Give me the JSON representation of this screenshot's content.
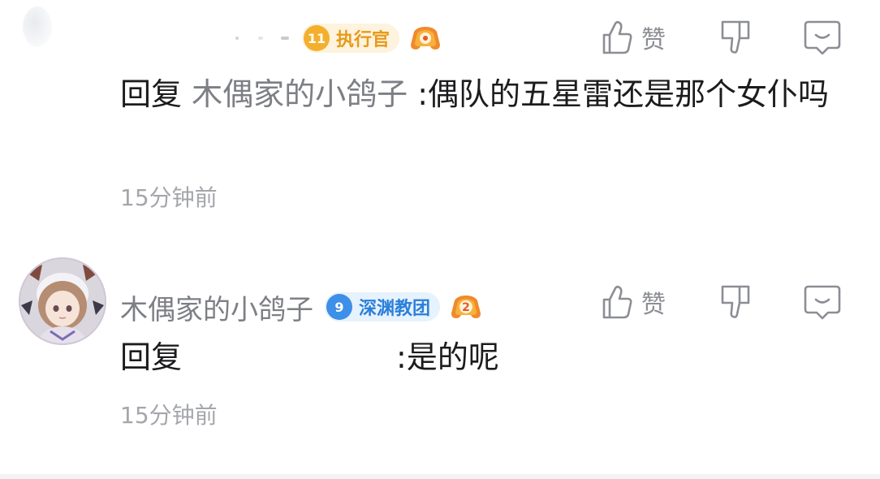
{
  "comments": [
    {
      "username": "",
      "level": "11",
      "level_title": "执行官",
      "level_color": "#f4b02d",
      "medal_icon": "game-controller-medal-icon",
      "reply_prefix": "回复",
      "reply_to": "木偶家的小鸽子",
      "text": ":偶队的五星雷还是那个女仆吗",
      "time": "15分钟前",
      "like_label": "赞"
    },
    {
      "username": "木偶家的小鸽子",
      "level": "9",
      "level_title": "深渊教团",
      "level_color": "#3d8fe8",
      "medal_icon": "game-controller-medal-2-icon",
      "medal_number": "2",
      "reply_prefix": "回复",
      "reply_to": "",
      "text": ":是的呢",
      "time": "15分钟前",
      "like_label": "赞"
    }
  ],
  "icons": {
    "like": "thumbs-up-icon",
    "dislike": "thumbs-down-icon",
    "reply": "comment-bubble-icon"
  }
}
